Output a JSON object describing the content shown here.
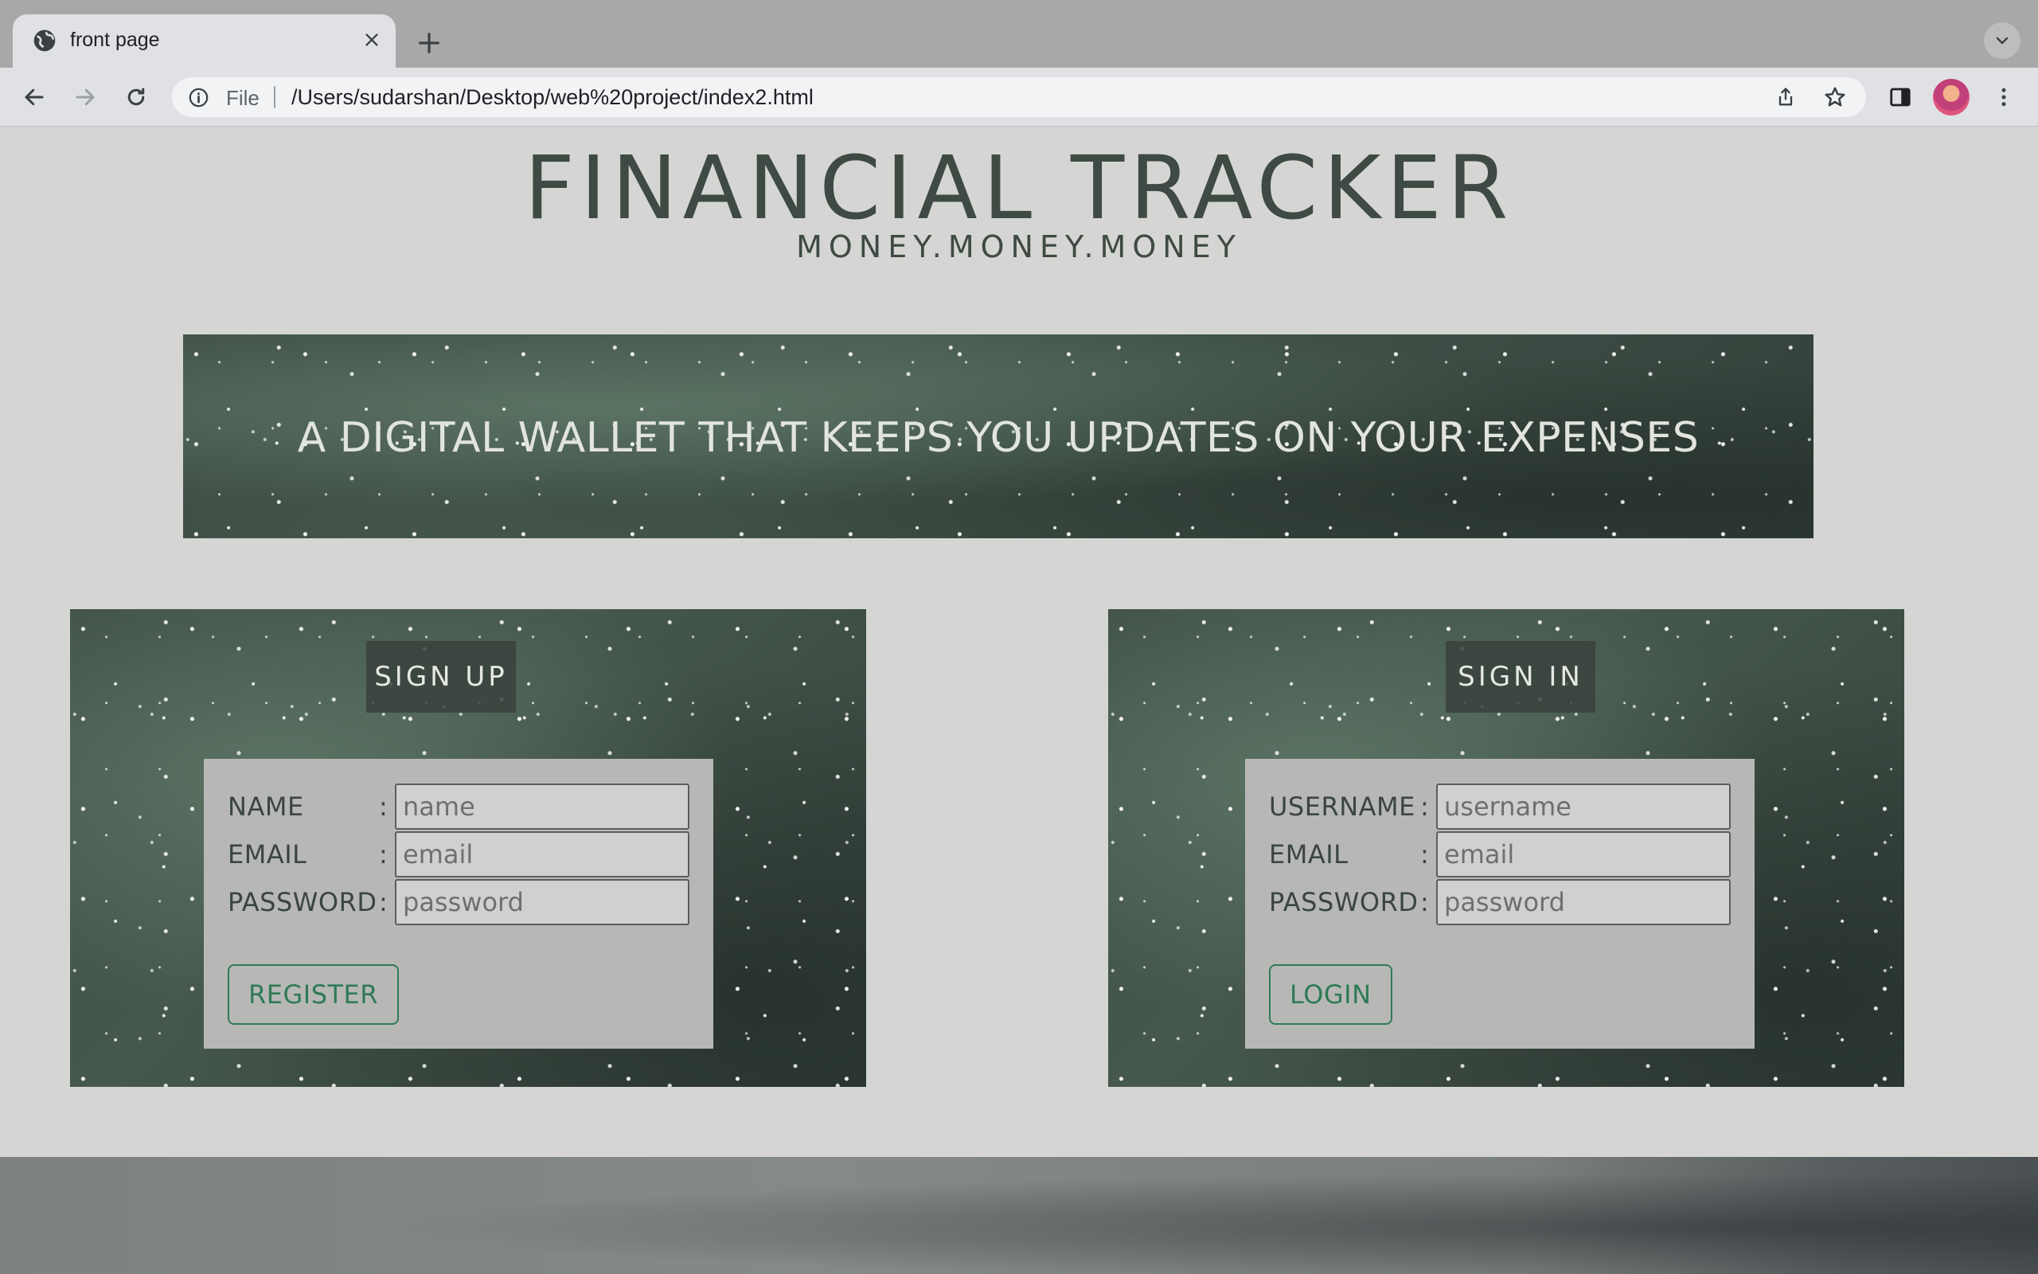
{
  "browser": {
    "tab_title": "front page",
    "scheme_label": "File",
    "url": "/Users/sudarshan/Desktop/web%20project/index2.html"
  },
  "page": {
    "title": "FINANCIAL TRACKER",
    "subtitle": "MONEY.MONEY.MONEY",
    "banner_text": "A DIGITAL WALLET THAT KEEPS YOU UPDATES ON YOUR EXPENSES"
  },
  "signup": {
    "heading": "SIGN UP",
    "fields": [
      {
        "label": "NAME",
        "placeholder": "name",
        "value": ""
      },
      {
        "label": "EMAIL",
        "placeholder": "email",
        "value": ""
      },
      {
        "label": "PASSWORD",
        "placeholder": "password",
        "value": ""
      }
    ],
    "button_label": "REGISTER"
  },
  "signin": {
    "heading": "SIGN IN",
    "fields": [
      {
        "label": "USERNAME",
        "placeholder": "username",
        "value": ""
      },
      {
        "label": "EMAIL",
        "placeholder": "email",
        "value": ""
      },
      {
        "label": "PASSWORD",
        "placeholder": "password",
        "value": ""
      }
    ],
    "button_label": "LOGIN"
  },
  "colors": {
    "page_bg": "#d5d6d3",
    "title_text": "#3e4a43",
    "button_accent": "#2f7a55",
    "panel_bg": "#3a4740"
  },
  "icons": [
    "globe-icon",
    "close-icon",
    "plus-icon",
    "chevron-down-icon",
    "back-arrow-icon",
    "forward-arrow-icon",
    "reload-icon",
    "info-icon",
    "share-icon",
    "star-icon",
    "side-panel-icon",
    "kebab-menu-icon"
  ]
}
